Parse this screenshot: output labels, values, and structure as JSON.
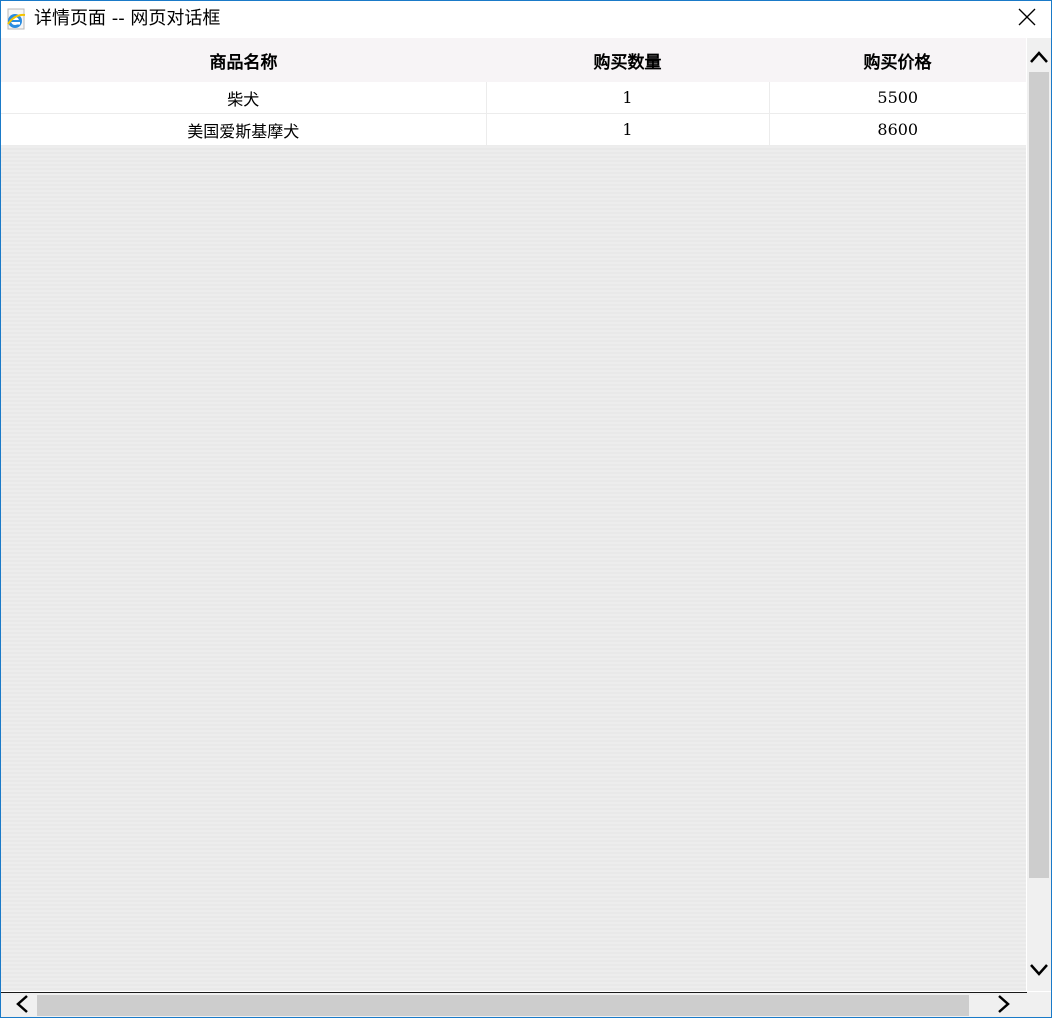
{
  "window": {
    "title": "详情页面 -- 网页对话框",
    "icon": "ie-icon",
    "close_icon": "close-icon"
  },
  "table": {
    "headers": [
      "商品名称",
      "购买数量",
      "购买价格"
    ],
    "rows": [
      [
        "柴犬",
        "1",
        "5500"
      ],
      [
        "美国爱斯基摩犬",
        "1",
        "8600"
      ]
    ]
  },
  "colors": {
    "header_bg": "#f7f4f6",
    "content_bg": "#ebebeb",
    "window_border": "#1a7ac8",
    "scroll_thumb": "#cdcdcd"
  }
}
